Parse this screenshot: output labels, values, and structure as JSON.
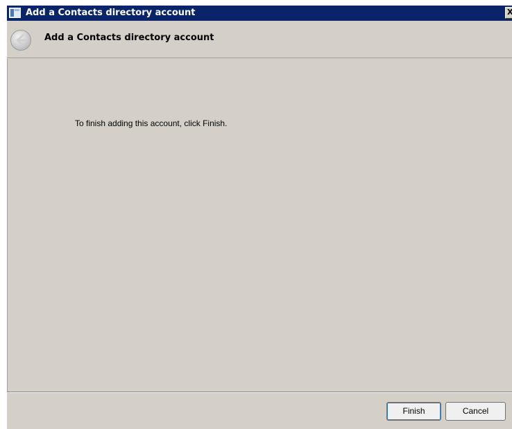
{
  "window": {
    "title": "Add a Contacts directory account",
    "close_glyph": "X"
  },
  "header": {
    "title": "Add a Contacts directory account",
    "back_icon": "back-arrow-icon"
  },
  "content": {
    "message": "To finish adding this account, click Finish."
  },
  "footer": {
    "finish_label": "Finish",
    "cancel_label": "Cancel"
  },
  "colors": {
    "titlebar": "#0a246a",
    "dialog_face": "#d4d0c8",
    "button_face": "#f0f0f0",
    "default_button_focus": "#3c7fb1"
  }
}
